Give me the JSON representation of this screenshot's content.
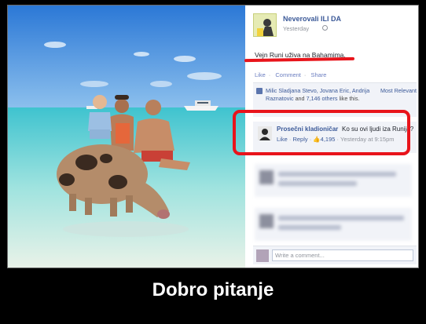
{
  "post": {
    "page_name": "Neverovali ILI DA",
    "time": "Yesterday",
    "text": "Vejn Runi uživa na Bahamima.",
    "actions": [
      "Like",
      "Comment",
      "Share"
    ]
  },
  "likes": {
    "names": "Milic Sladjana Stevo, Jovana Eric, Andrija Raznatovic",
    "others_link": "7,146 others",
    "conjunction": "and",
    "suffix": "like this.",
    "sort_label": "Most Relevant"
  },
  "comment": {
    "author": "Prosečni kladioničar",
    "text": "Ko su ovi ljudi iza Runija?",
    "like": "Like",
    "reply": "Reply",
    "like_count": "4,195",
    "time": "Yesterday at 9:15pm"
  },
  "write_comment": {
    "placeholder": "Write a comment..."
  },
  "caption": "Dobro pitanje",
  "colors": {
    "fb_blue": "#3b5998",
    "highlight_red": "#e8141b",
    "background": "#000000"
  }
}
